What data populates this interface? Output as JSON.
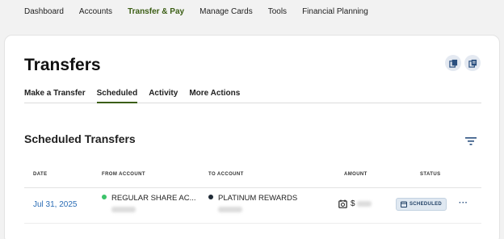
{
  "top_nav": {
    "items": [
      {
        "label": "Dashboard",
        "active": false
      },
      {
        "label": "Accounts",
        "active": false
      },
      {
        "label": "Transfer & Pay",
        "active": true
      },
      {
        "label": "Manage Cards",
        "active": false
      },
      {
        "label": "Tools",
        "active": false
      },
      {
        "label": "Financial Planning",
        "active": false
      }
    ]
  },
  "page": {
    "title": "Transfers",
    "action_icons": [
      "copy-icon",
      "duplicate-icon"
    ]
  },
  "tabs": [
    {
      "label": "Make a Transfer",
      "active": false
    },
    {
      "label": "Scheduled",
      "active": true
    },
    {
      "label": "Activity",
      "active": false
    },
    {
      "label": "More Actions",
      "active": false
    }
  ],
  "section": {
    "title": "Scheduled Transfers",
    "filter_icon": "filter-icon"
  },
  "table": {
    "headers": {
      "date": "DATE",
      "from": "FROM ACCOUNT",
      "to": "TO ACCOUNT",
      "amount": "AMOUNT",
      "status": "STATUS"
    },
    "rows": [
      {
        "date": "Jul 31, 2025",
        "from_account": "REGULAR SHARE AC...",
        "from_color": "#3cc36a",
        "to_account": "PLATINUM REWARDS",
        "to_color": "#1f2a36",
        "amount_prefix": "$",
        "status": "SCHEDULED",
        "more": "···"
      }
    ]
  },
  "colors": {
    "accent_green": "#3b5e14",
    "link_blue": "#2a6cb5",
    "badge_bg": "#dfe8f1"
  }
}
